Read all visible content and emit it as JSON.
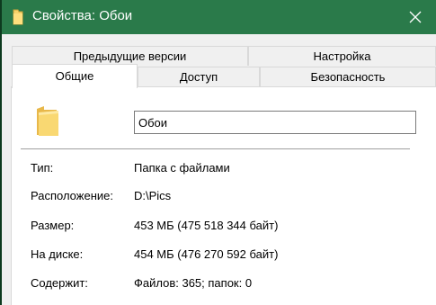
{
  "window": {
    "title": "Свойства: Обои",
    "title_icon": "folder-icon",
    "close_icon": "close-icon",
    "accent_color": "#2a7a4a"
  },
  "tabs": {
    "row1": [
      {
        "label": "Предыдущие версии"
      },
      {
        "label": "Настройка"
      }
    ],
    "row2": [
      {
        "label": "Общие",
        "active": true
      },
      {
        "label": "Доступ"
      },
      {
        "label": "Безопасность"
      }
    ]
  },
  "general": {
    "name_value": "Обои",
    "properties": [
      {
        "label": "Тип:",
        "value": "Папка с файлами"
      },
      {
        "label": "Расположение:",
        "value": "D:\\Pics"
      },
      {
        "label": "Размер:",
        "value": "453 МБ (475 518 344 байт)"
      },
      {
        "label": "На диске:",
        "value": "454 МБ (476 270 592 байт)"
      },
      {
        "label": "Содержит:",
        "value": "Файлов: 365; папок: 0"
      }
    ]
  }
}
